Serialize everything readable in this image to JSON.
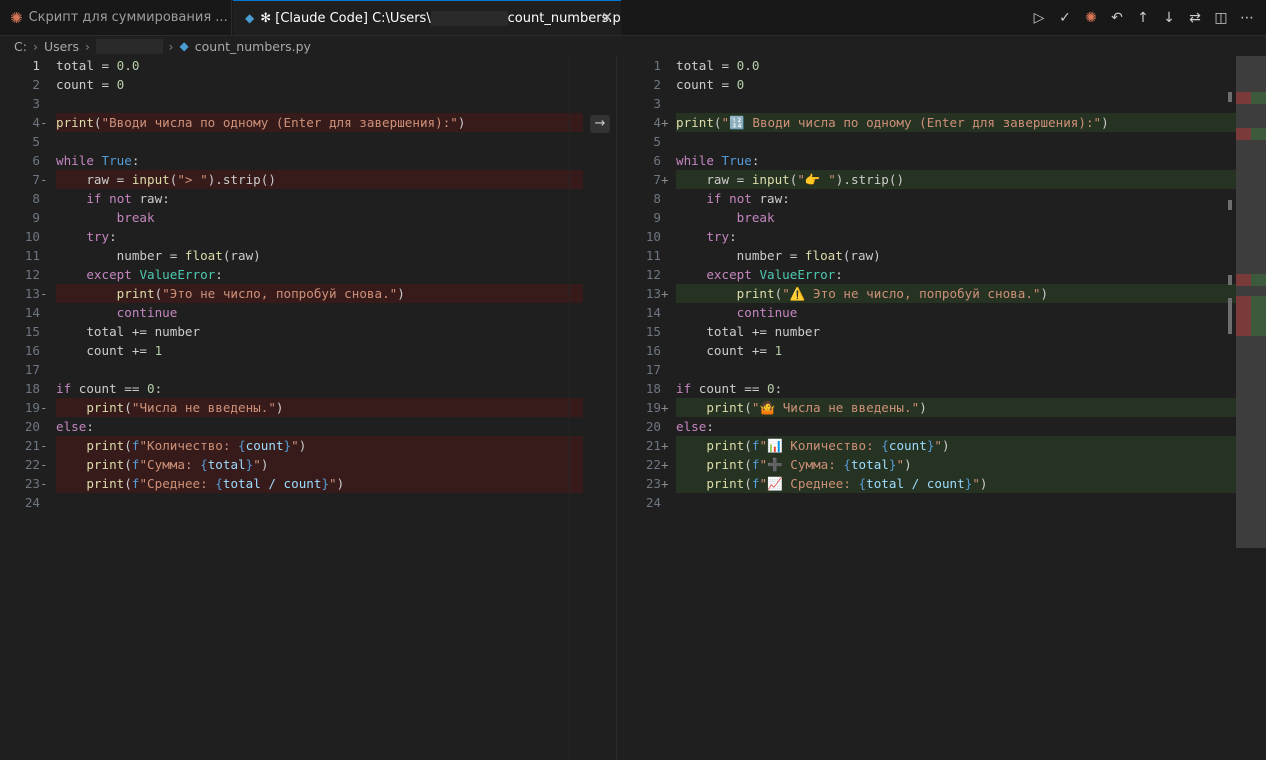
{
  "tabs": [
    {
      "label": "Скрипт для суммирования ..."
    },
    {
      "label_prefix": "✻ [Claude Code] C:\\Users\\",
      "label_suffix": "count_numbers.py"
    }
  ],
  "icons": {
    "claude": "claude-asterisk-icon",
    "python": "python-file-icon",
    "close": "close-icon"
  },
  "breadcrumb": {
    "drive": "C:",
    "users": "Users",
    "file": "count_numbers.py"
  },
  "colors": {
    "deleted": "#4b1818",
    "added": "#2a3a24",
    "accent": "#0078d4"
  },
  "left": {
    "lines": [
      {
        "n": "1",
        "t": "total = 0.0"
      },
      {
        "n": "2",
        "t": "count = 0"
      },
      {
        "n": "3",
        "t": ""
      },
      {
        "n": "4",
        "t": "print(\"Вводи числа по одному (Enter для завершения):\")",
        "mod": "del"
      },
      {
        "n": "5",
        "t": ""
      },
      {
        "n": "6",
        "t": "while True:"
      },
      {
        "n": "7",
        "t": "    raw = input(\"> \").strip()",
        "mod": "del"
      },
      {
        "n": "8",
        "t": "    if not raw:"
      },
      {
        "n": "9",
        "t": "        break"
      },
      {
        "n": "10",
        "t": "    try:"
      },
      {
        "n": "11",
        "t": "        number = float(raw)"
      },
      {
        "n": "12",
        "t": "    except ValueError:"
      },
      {
        "n": "13",
        "t": "        print(\"Это не число, попробуй снова.\")",
        "mod": "del"
      },
      {
        "n": "14",
        "t": "        continue"
      },
      {
        "n": "15",
        "t": "    total += number"
      },
      {
        "n": "16",
        "t": "    count += 1"
      },
      {
        "n": "17",
        "t": ""
      },
      {
        "n": "18",
        "t": "if count == 0:"
      },
      {
        "n": "19",
        "t": "    print(\"Числа не введены.\")",
        "mod": "del"
      },
      {
        "n": "20",
        "t": "else:"
      },
      {
        "n": "21",
        "t": "    print(f\"Количество: {count}\")",
        "mod": "del"
      },
      {
        "n": "22",
        "t": "    print(f\"Сумма: {total}\")",
        "mod": "del"
      },
      {
        "n": "23",
        "t": "    print(f\"Среднее: {total / count}\")",
        "mod": "del"
      },
      {
        "n": "24",
        "t": ""
      }
    ]
  },
  "right": {
    "lines": [
      {
        "n": "1",
        "t": "total = 0.0"
      },
      {
        "n": "2",
        "t": "count = 0"
      },
      {
        "n": "3",
        "t": ""
      },
      {
        "n": "4",
        "t": "print(\"🔢 Вводи числа по одному (Enter для завершения):\")",
        "mod": "add"
      },
      {
        "n": "5",
        "t": ""
      },
      {
        "n": "6",
        "t": "while True:"
      },
      {
        "n": "7",
        "t": "    raw = input(\"👉 \").strip()",
        "mod": "add"
      },
      {
        "n": "8",
        "t": "    if not raw:"
      },
      {
        "n": "9",
        "t": "        break"
      },
      {
        "n": "10",
        "t": "    try:"
      },
      {
        "n": "11",
        "t": "        number = float(raw)"
      },
      {
        "n": "12",
        "t": "    except ValueError:"
      },
      {
        "n": "13",
        "t": "        print(\"⚠️ Это не число, попробуй снова.\")",
        "mod": "add"
      },
      {
        "n": "14",
        "t": "        continue"
      },
      {
        "n": "15",
        "t": "    total += number"
      },
      {
        "n": "16",
        "t": "    count += 1"
      },
      {
        "n": "17",
        "t": ""
      },
      {
        "n": "18",
        "t": "if count == 0:"
      },
      {
        "n": "19",
        "t": "    print(\"🤷 Числа не введены.\")",
        "mod": "add"
      },
      {
        "n": "20",
        "t": "else:"
      },
      {
        "n": "21",
        "t": "    print(f\"📊 Количество: {count}\")",
        "mod": "add"
      },
      {
        "n": "22",
        "t": "    print(f\"➕ Сумма: {total}\")",
        "mod": "add"
      },
      {
        "n": "23",
        "t": "    print(f\"📈 Среднее: {total / count}\")",
        "mod": "add"
      },
      {
        "n": "24",
        "t": ""
      }
    ]
  },
  "toolbar": [
    {
      "name": "run-icon",
      "glyph": "▷"
    },
    {
      "name": "accept-icon",
      "glyph": "✓"
    },
    {
      "name": "claude-icon",
      "glyph": "✺"
    },
    {
      "name": "undo-icon",
      "glyph": "↶"
    },
    {
      "name": "arrow-up-icon",
      "glyph": "↑"
    },
    {
      "name": "arrow-down-icon",
      "glyph": "↓"
    },
    {
      "name": "swap-icon",
      "glyph": "⇄"
    },
    {
      "name": "split-editor-icon",
      "glyph": "◫"
    },
    {
      "name": "more-icon",
      "glyph": "⋯"
    }
  ]
}
